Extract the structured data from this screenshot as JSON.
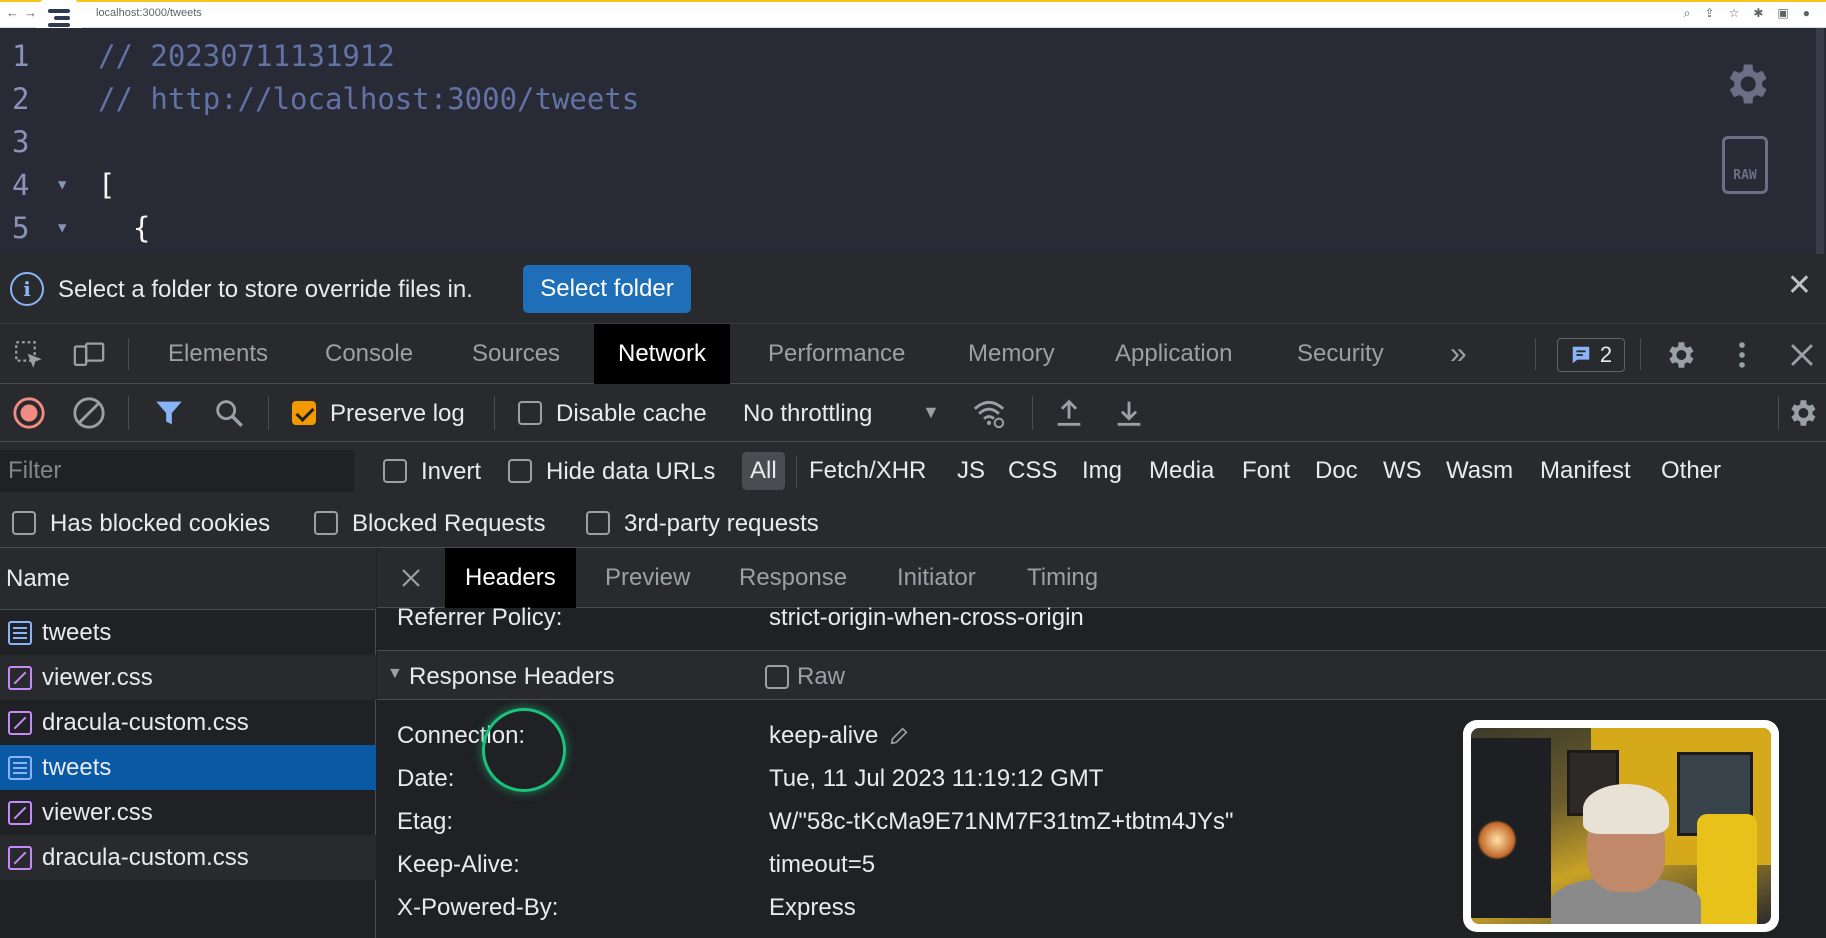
{
  "browser": {
    "url": "localhost:3000/tweets"
  },
  "viewer": {
    "lines": [
      {
        "num": "1",
        "text": "// 20230711131912",
        "fold": ""
      },
      {
        "num": "2",
        "text": "// http://localhost:3000/tweets",
        "fold": ""
      },
      {
        "num": "3",
        "text": "",
        "fold": ""
      },
      {
        "num": "4",
        "text": "[",
        "fold": "▼"
      },
      {
        "num": "5",
        "text": "  {",
        "fold": "▼"
      }
    ],
    "raw_label": "RAW"
  },
  "infobar": {
    "message": "Select a folder to store override files in.",
    "button": "Select folder"
  },
  "devtools": {
    "tabs": {
      "elements": "Elements",
      "console": "Console",
      "sources": "Sources",
      "network": "Network",
      "performance": "Performance",
      "memory": "Memory",
      "application": "Application",
      "security": "Security",
      "more": "»"
    },
    "issues_count": "2"
  },
  "network_toolbar": {
    "preserve_log": "Preserve log",
    "disable_cache": "Disable cache",
    "throttling": "No throttling"
  },
  "filter": {
    "placeholder": "Filter",
    "invert": "Invert",
    "hide_data_urls": "Hide data URLs",
    "types": [
      "All",
      "Fetch/XHR",
      "JS",
      "CSS",
      "Img",
      "Media",
      "Font",
      "Doc",
      "WS",
      "Wasm",
      "Manifest",
      "Other"
    ],
    "has_blocked_cookies": "Has blocked cookies",
    "blocked_requests": "Blocked Requests",
    "third_party": "3rd-party requests"
  },
  "requests": {
    "header": "Name",
    "items": [
      {
        "name": "tweets",
        "type": "doc"
      },
      {
        "name": "viewer.css",
        "type": "css"
      },
      {
        "name": "dracula-custom.css",
        "type": "css"
      },
      {
        "name": "tweets",
        "type": "doc"
      },
      {
        "name": "viewer.css",
        "type": "css"
      },
      {
        "name": "dracula-custom.css",
        "type": "css"
      }
    ]
  },
  "detail": {
    "tabs": {
      "headers": "Headers",
      "preview": "Preview",
      "response": "Response",
      "initiator": "Initiator",
      "timing": "Timing"
    },
    "referrer_key": "Referrer Policy:",
    "referrer_val": "strict-origin-when-cross-origin",
    "section_title": "Response Headers",
    "raw_label": "Raw",
    "headers": [
      {
        "key": "Connection:",
        "value": "keep-alive"
      },
      {
        "key": "Date:",
        "value": "Tue, 11 Jul 2023 11:19:12 GMT"
      },
      {
        "key": "Etag:",
        "value": "W/\"58c-tKcMa9E71NM7F31tmZ+tbtm4JYs\""
      },
      {
        "key": "Keep-Alive:",
        "value": "timeout=5"
      },
      {
        "key": "X-Powered-By:",
        "value": "Express"
      }
    ]
  }
}
